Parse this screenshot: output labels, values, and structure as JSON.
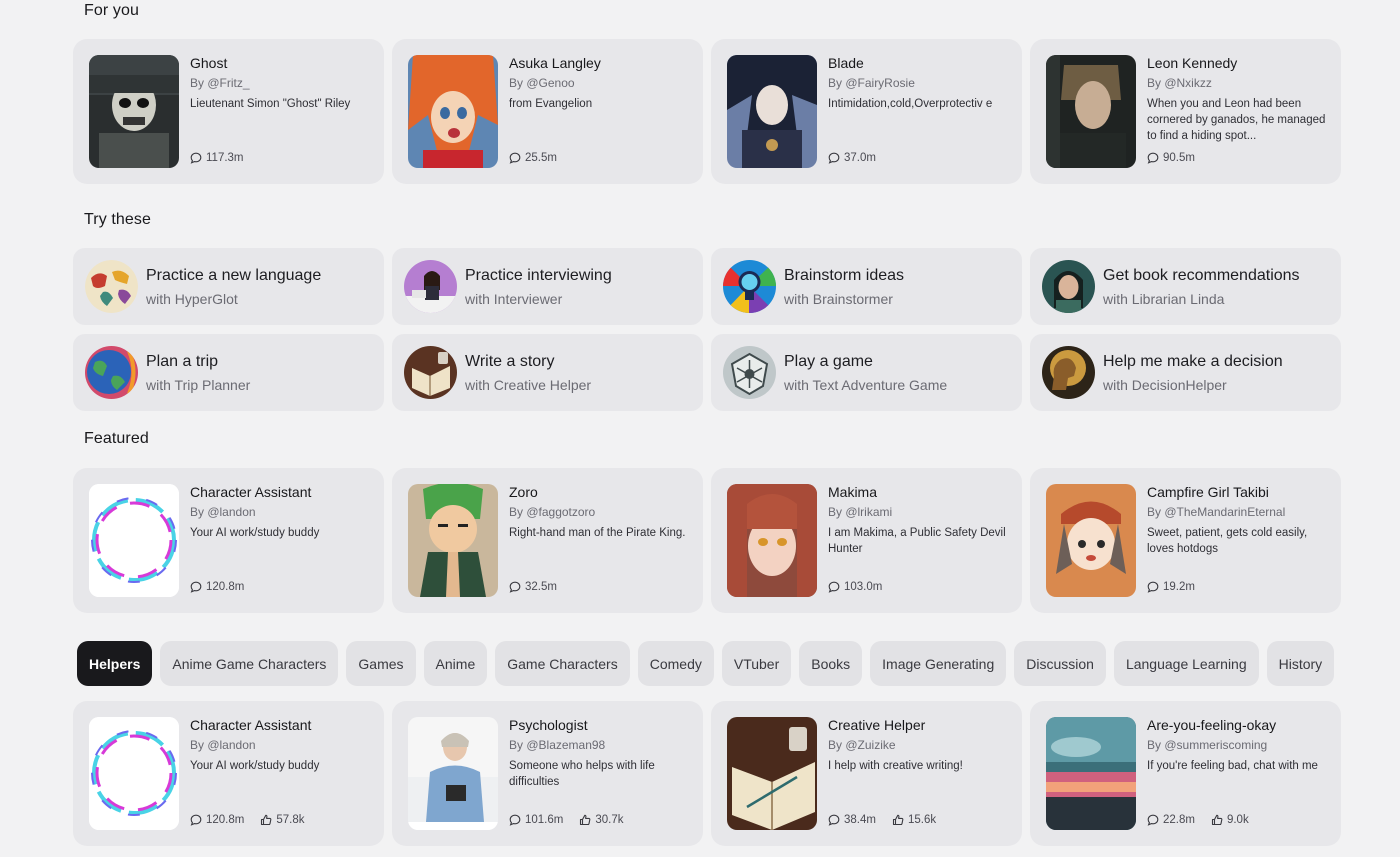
{
  "sections": {
    "for_you": "For you",
    "try_these": "Try these",
    "featured": "Featured"
  },
  "for_you": [
    {
      "name": "Ghost",
      "author": "By @Fritz_",
      "desc": "Lieutenant Simon \"Ghost\" Riley",
      "chats": "117.3m"
    },
    {
      "name": "Asuka Langley",
      "author": "By @Genoo",
      "desc": "from Evangelion",
      "chats": "25.5m"
    },
    {
      "name": "Blade",
      "author": "By @FairyRosie",
      "desc": "Intimidation,cold,Overprotectiv e",
      "chats": "37.0m"
    },
    {
      "name": "Leon Kennedy",
      "author": "By @Nxikzz",
      "desc": "When you and Leon had been cornered by ganados, he managed to find a hiding spot...",
      "chats": "90.5m"
    }
  ],
  "try_these": [
    {
      "title": "Practice a new language",
      "sub": "with HyperGlot"
    },
    {
      "title": "Practice interviewing",
      "sub": "with Interviewer"
    },
    {
      "title": "Brainstorm ideas",
      "sub": "with Brainstormer"
    },
    {
      "title": "Get book recommendations",
      "sub": "with Librarian Linda"
    },
    {
      "title": "Plan a trip",
      "sub": "with Trip Planner"
    },
    {
      "title": "Write a story",
      "sub": "with Creative Helper"
    },
    {
      "title": "Play a game",
      "sub": "with Text Adventure Game"
    },
    {
      "title": "Help me make a decision",
      "sub": "with DecisionHelper"
    }
  ],
  "featured": [
    {
      "name": "Character Assistant",
      "author": "By @landon",
      "desc": "Your AI work/study buddy",
      "chats": "120.8m"
    },
    {
      "name": "Zoro",
      "author": "By @faggotzoro",
      "desc": "Right-hand man of the Pirate King.",
      "chats": "32.5m"
    },
    {
      "name": "Makima",
      "author": "By @lrikami",
      "desc": "I am Makima, a Public Safety Devil Hunter",
      "chats": "103.0m"
    },
    {
      "name": "Campfire Girl Takibi",
      "author": "By @TheMandarinEternal",
      "desc": "Sweet, patient, gets cold easily, loves hotdogs",
      "chats": "19.2m"
    }
  ],
  "categories": [
    "Helpers",
    "Anime Game Characters",
    "Games",
    "Anime",
    "Game Characters",
    "Comedy",
    "VTuber",
    "Books",
    "Image Generating",
    "Discussion",
    "Language Learning",
    "History"
  ],
  "active_category": "Helpers",
  "helpers": [
    {
      "name": "Character Assistant",
      "author": "By @landon",
      "desc": "Your AI work/study buddy",
      "chats": "120.8m",
      "likes": "57.8k"
    },
    {
      "name": "Psychologist",
      "author": "By @Blazeman98",
      "desc": "Someone who helps with life difficulties",
      "chats": "101.6m",
      "likes": "30.7k"
    },
    {
      "name": "Creative Helper",
      "author": "By @Zuizike",
      "desc": "I help with creative writing!",
      "chats": "38.4m",
      "likes": "15.6k"
    },
    {
      "name": "Are-you-feeling-okay",
      "author": "By @summeriscoming",
      "desc": "If you're feeling bad, chat with me",
      "chats": "22.8m",
      "likes": "9.0k"
    }
  ],
  "icons": {
    "chat": "chat-bubble-icon",
    "like": "thumbs-up-icon"
  }
}
